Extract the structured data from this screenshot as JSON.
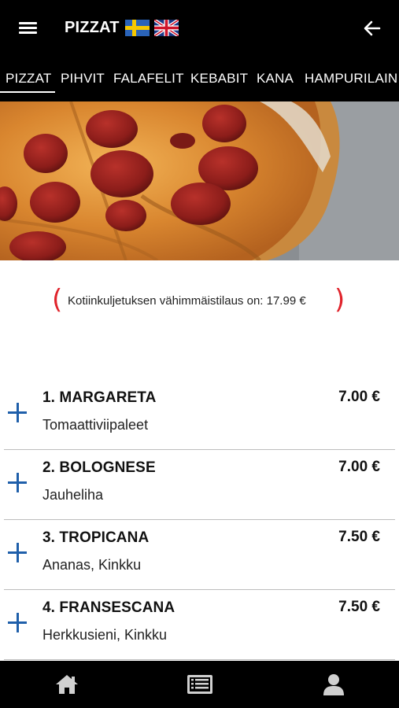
{
  "header": {
    "title": "PIZZAT",
    "languages": [
      "swedish-flag-icon",
      "uk-flag-icon"
    ],
    "menu_icon": "hamburger-menu-icon",
    "back_icon": "arrow-left-icon"
  },
  "tabs": [
    {
      "label": "PIZZAT",
      "active": true
    },
    {
      "label": "PIHVIT",
      "active": false
    },
    {
      "label": "FALAFELIT",
      "active": false
    },
    {
      "label": "KEBABIT",
      "active": false
    },
    {
      "label": "KANA",
      "active": false
    },
    {
      "label": "HAMPURILAIN",
      "active": false
    }
  ],
  "hero": {
    "image": "pepperoni-pizza-photo"
  },
  "notice": {
    "text": "Kotiinkuljetuksen vähimmäistilaus on: 17.99 €"
  },
  "items": [
    {
      "name": "1. MARGARETA",
      "price": "7.00 €",
      "desc": "Tomaattiviipaleet"
    },
    {
      "name": "2. BOLOGNESE",
      "price": "7.00 €",
      "desc": "Jauheliha"
    },
    {
      "name": "3. TROPICANA",
      "price": "7.50 €",
      "desc": "Ananas, Kinkku"
    },
    {
      "name": "4. FRANSESCANA",
      "price": "7.50 €",
      "desc": "Herkkusieni, Kinkku"
    }
  ],
  "bottom_nav": [
    "home-icon",
    "menu-list-icon",
    "user-icon"
  ],
  "colors": {
    "bar": "#000000",
    "accent_blue": "#1f5faa",
    "bracket_red": "#e0232b"
  }
}
